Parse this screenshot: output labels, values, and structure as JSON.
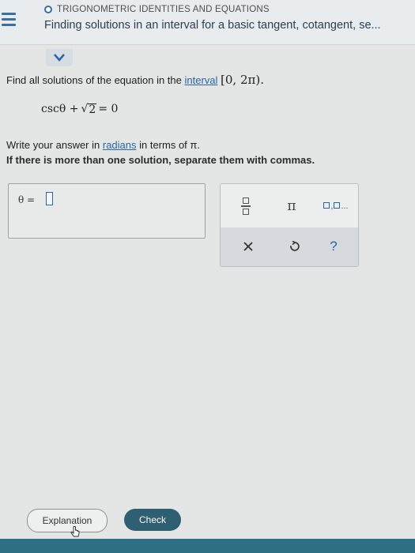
{
  "header": {
    "topic": "TRIGONOMETRIC IDENTITIES AND EQUATIONS",
    "lesson": "Finding solutions in an interval for a basic tangent, cotangent, se..."
  },
  "problem": {
    "intro": "Find all solutions of the equation in the ",
    "interval_link": "interval",
    "interval": "[0, 2π).",
    "equation_lhs": "cscθ +",
    "radicand": "2",
    "equation_rhs": "= 0",
    "instruction_pre": "Write your answer in ",
    "radians_link": "radians",
    "instruction_post": " in terms of π.",
    "instruction_bold": "If there is more than one solution, separate them with commas."
  },
  "answer": {
    "label": "θ ="
  },
  "palette": {
    "pi": "π",
    "list_suffix": "..."
  },
  "footer": {
    "explanation": "Explanation",
    "check": "Check"
  },
  "colors": {
    "accent": "#2a64a8",
    "check_button": "#2f5f73",
    "bottom_bar": "#2e6f83"
  },
  "icons": [
    "menu-icon",
    "chevron-down-icon",
    "fraction-icon",
    "pi-icon",
    "list-icon",
    "close-icon",
    "undo-icon",
    "help-icon",
    "hand-cursor-icon"
  ]
}
